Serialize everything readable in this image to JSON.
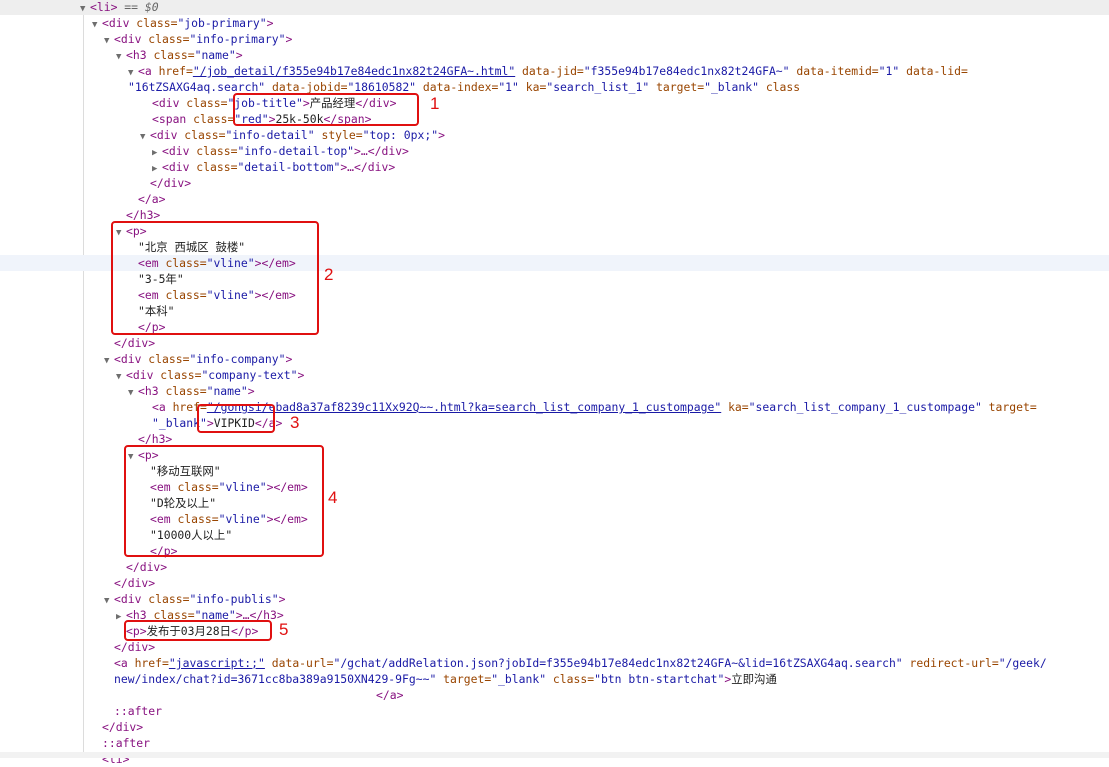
{
  "lines": {
    "l0": {
      "tag": "<li>",
      "eq": " == $0"
    },
    "l1": {
      "open": "<div ",
      "a": "class=",
      "v": "\"job-primary\"",
      "close": ">"
    },
    "l2": {
      "open": "<div ",
      "a": "class=",
      "v": "\"info-primary\"",
      "close": ">"
    },
    "l3": {
      "open": "<h3 ",
      "a": "class=",
      "v": "\"name\"",
      "close": ">"
    },
    "l4": {
      "open": "<a ",
      "a1": "href=",
      "v1": "\"/job_detail/f355e94b17e84edc1nx82t24GFA~.html\"",
      "a2": " data-jid=",
      "v2": "\"f355e94b17e84edc1nx82t24GFA~\"",
      "a3": " data-itemid=",
      "v3": "\"1\"",
      "a4": " data-lid=",
      "v4": ""
    },
    "l5": {
      "v4b": "\"16tZSAXG4aq.search\"",
      "a5": " data-jobid=",
      "v5": "\"18610582\"",
      "a6": " data-index=",
      "v6": "\"1\"",
      "a7": " ka=",
      "v7": "\"search_list_1\"",
      "a8": " target=",
      "v8": "\"_blank\"",
      "a9": " class"
    },
    "l6": {
      "open": "<div ",
      "a": "class=",
      "v": "\"job-title\"",
      "close": ">",
      "text": "产品经理",
      "end": "</div>"
    },
    "l7": {
      "open": "<span ",
      "a": "class=",
      "v": "\"red\"",
      "close": ">",
      "text": "25k-50k",
      "end": "</span>"
    },
    "l8": {
      "open": "<div ",
      "a1": "class=",
      "v1": "\"info-detail\"",
      "a2": " style=",
      "v2": "\"top: 0px;\"",
      "close": ">"
    },
    "l9": {
      "open": "<div ",
      "a": "class=",
      "v": "\"info-detail-top\"",
      "close": ">…</div>"
    },
    "l10": {
      "open": "<div ",
      "a": "class=",
      "v": "\"detail-bottom\"",
      "close": ">…</div>"
    },
    "l11": {
      "end": "</div>"
    },
    "l12": {
      "end": "</a>"
    },
    "l13": {
      "end": "</h3>"
    },
    "l14": {
      "open": "<p>"
    },
    "l15": {
      "text": "\"北京 西城区 鼓楼\""
    },
    "l16": {
      "open": "<em ",
      "a": "class=",
      "v": "\"vline\"",
      "close": "></em>"
    },
    "l17": {
      "text": "\"3-5年\""
    },
    "l18": {
      "open": "<em ",
      "a": "class=",
      "v": "\"vline\"",
      "close": "></em>"
    },
    "l19": {
      "text": "\"本科\""
    },
    "l20": {
      "end": "</p>"
    },
    "l21": {
      "end": "</div>"
    },
    "l22": {
      "open": "<div ",
      "a": "class=",
      "v": "\"info-company\"",
      "close": ">"
    },
    "l23": {
      "open": "<div ",
      "a": "class=",
      "v": "\"company-text\"",
      "close": ">"
    },
    "l24": {
      "open": "<h3 ",
      "a": "class=",
      "v": "\"name\"",
      "close": ">"
    },
    "l25": {
      "open": "<a ",
      "a1": "href=",
      "v1": "\"/gongsi/ebad8a37af8239c11Xx92Q~~.html?ka=search_list_company_1_custompage\"",
      "a2": " ka=",
      "v2": "\"search_list_company_1_custompage\"",
      "a3": " target="
    },
    "l26": {
      "v3": "\"_blank\"",
      "close": ">",
      "text": "VIPKID",
      "end": "</a>"
    },
    "l27": {
      "end": "</h3>"
    },
    "l28": {
      "open": "<p>"
    },
    "l29": {
      "text": "\"移动互联网\""
    },
    "l30": {
      "open": "<em ",
      "a": "class=",
      "v": "\"vline\"",
      "close": "></em>"
    },
    "l31": {
      "text": "\"D轮及以上\""
    },
    "l32": {
      "open": "<em ",
      "a": "class=",
      "v": "\"vline\"",
      "close": "></em>"
    },
    "l33": {
      "text": "\"10000人以上\""
    },
    "l34": {
      "end": "</p>"
    },
    "l35": {
      "end": "</div>"
    },
    "l36": {
      "end": "</div>"
    },
    "l37": {
      "open": "<div ",
      "a": "class=",
      "v": "\"info-publis\"",
      "close": ">"
    },
    "l38": {
      "open": "<h3 ",
      "a": "class=",
      "v": "\"name\"",
      "close": ">…</h3>"
    },
    "l39": {
      "open": "<p>",
      "text": "发布于03月28日",
      "end": "</p>"
    },
    "l40": {
      "end": "</div>"
    },
    "l41": {
      "open": "<a ",
      "a1": "href=",
      "v1": "\"javascript:;\"",
      "a2": " data-url=",
      "v2": "\"/gchat/addRelation.json?jobId=f355e94b17e84edc1nx82t24GFA~&lid=16tZSAXG4aq.search\"",
      "a3": " redirect-url=",
      "v3": "\"/geek/"
    },
    "l42": {
      "v3b": "new/index/chat?id=3671cc8ba389a9150XN429-9Fg~~\"",
      "a4": " target=",
      "v4": "\"_blank\"",
      "a5": " class=",
      "v5": "\"btn btn-startchat\"",
      "close": ">",
      "text": "立即沟通"
    },
    "l43": {
      "end": "</a>"
    },
    "l44": {
      "pseudo": "::after"
    },
    "l45": {
      "end": "</div>"
    },
    "l46": {
      "pseudo": "::after"
    },
    "l47": {
      "open": "<li>"
    }
  },
  "annotations": {
    "n1": "1",
    "n2": "2",
    "n3": "3",
    "n4": "4",
    "n5": "5"
  },
  "colors": {
    "annotation": "#e01010",
    "tag": "#881280",
    "attr": "#994500",
    "value": "#1a1aa6"
  }
}
